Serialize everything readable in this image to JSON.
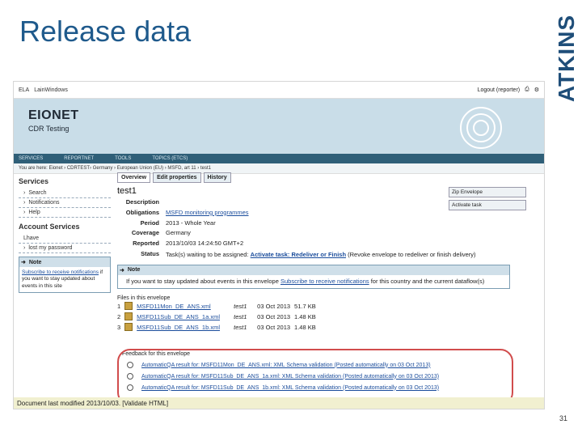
{
  "slide": {
    "title": "Release data",
    "logo_text": "ATKINS",
    "page_number": "31",
    "accent_color": "#1f5a8c"
  },
  "screenshot": {
    "topbar": {
      "left_items": [
        "ELA",
        "LainWindows"
      ],
      "right_label": "Logout (reporter)"
    },
    "banner": {
      "title": "EIONET",
      "subtitle": "CDR Testing"
    },
    "nav": [
      "SERVICES",
      "REPORTNET",
      "TOOLS",
      "TOPICS (ETCS)"
    ],
    "breadcrumb": "You are here: Eionet › CDRTEST› Germany › European Union (EU) › MSFD, art 11 › test1",
    "sidebar": {
      "services_heading": "Services",
      "services_items": [
        "Search",
        "Notifications",
        "Help"
      ],
      "account_heading": "Account Services",
      "account_items": [
        "Lhave",
        "lost my password"
      ],
      "note_label": "Note",
      "note_link": "Subscribe to receive notifications",
      "note_text": "if you want to stay updated about events in this site"
    },
    "tabs": [
      "Overview",
      "Edit properties",
      "History"
    ],
    "envelope_title": "test1",
    "actions": [
      "Zip Envelope",
      "Activate task"
    ],
    "fields": [
      {
        "label": "Description",
        "value": ""
      },
      {
        "label": "Obligations",
        "value": "MSFD monitoring programmes"
      },
      {
        "label": "Period",
        "value": "2013 - Whole Year"
      },
      {
        "label": "Coverage",
        "value": "Germany"
      },
      {
        "label": "Reported",
        "value": "2013/10/03 14:24:50 GMT+2"
      }
    ],
    "status_label": "Status",
    "status_text_1": "Task(s) waiting to be assigned:",
    "status_link": "Activate task: Redeliver or Finish",
    "status_text_2": "(Revoke envelope to redeliver or finish delivery)",
    "note_label": "Note",
    "note_text_1": "If you want to stay updated about events in this envelope",
    "note_link": "Subscribe to receive notifications",
    "note_text_2": "for this country and the current dataflow(s)",
    "files_heading": "Files in this envelope",
    "files": [
      {
        "index": "1",
        "name": "MSFD11Mon_DE_ANS.xml",
        "owner": "test1",
        "date": "03 Oct 2013",
        "size": "51.7 KB"
      },
      {
        "index": "2",
        "name": "MSFD11Sub_DE_ANS_1a.xml",
        "owner": "test1",
        "date": "03 Oct 2013",
        "size": "1.48 KB"
      },
      {
        "index": "3",
        "name": "MSFD11Sub_DE_ANS_1b.xml",
        "owner": "test1",
        "date": "03 Oct 2013",
        "size": "1.48 KB"
      }
    ],
    "feedback_heading": "Feedback for this envelope",
    "feedback": [
      "AutomaticQA result for: MSFD11Mon_DE_ANS.xml: XML Schema validation (Posted automatically on 03 Oct 2013)",
      "AutomaticQA result for: MSFD11Sub_DE_ANS_1a.xml: XML Schema validation (Posted automatically on 03 Oct 2013)",
      "AutomaticQA result for: MSFD11Sub_DE_ANS_1b.xml: XML Schema validation (Posted automatically on 03 Oct 2013)"
    ],
    "footer": "Document last modified 2013/10/03. [Validate HTML]"
  }
}
